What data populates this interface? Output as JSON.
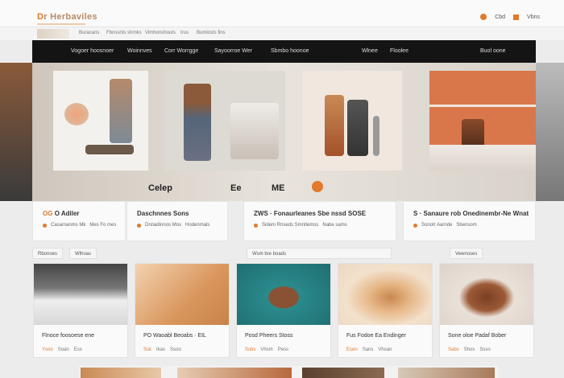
{
  "header": {
    "logo_accent": "D",
    "logo_rest": "r Herbaviles",
    "cart_label": "Cbd",
    "account_label": "Vbns"
  },
  "breadcrumb": {
    "items": [
      "Buracans",
      "Fbnssnts shrnks",
      "Vimhonshouts",
      "Irus",
      "Bumlosts fins"
    ]
  },
  "nav": {
    "items": [
      "Vogoer hoosnoer",
      "Woinnves",
      "Corr Worrgge",
      "Sayoorroe Wer",
      "Sbmbo hoonoe",
      "Wlnee",
      "Floolee",
      "Buol oone"
    ]
  },
  "hero": {
    "caption_1": "Celep",
    "caption_2": "Ee",
    "caption_3": "ME"
  },
  "cards": [
    {
      "title_accent": "OG",
      "title_rest": "O Adiler",
      "meta_1": "Casamanms Mk",
      "meta_2": "Mes Fo mes"
    },
    {
      "title_accent": "",
      "title_rest": "Daschnnes Sons",
      "meta_1": "Dnnadinnos Mos",
      "meta_2": "Hodenmals"
    },
    {
      "title_accent": "",
      "title_rest": "ZWS · Fonaurleanes Sbe nssd SOSE",
      "meta_1": "Sidem Rnseds Smntlemss",
      "meta_2": "Nabe sams"
    },
    {
      "title_accent": "",
      "title_rest": "S · Sanaure rob Onedinembr-Ne Wnat",
      "meta_1": "Sonotr Aarnde",
      "meta_2": "Sbensom"
    }
  ],
  "filters": [
    "Rbonoes",
    "Wlhoas",
    "Wsm bre boads",
    "Vewnoses"
  ],
  "products": [
    {
      "name": "Flnoce foosoese ene",
      "price_accent": "Ysoo",
      "price_1": "Soan",
      "price_2": "Ess"
    },
    {
      "name": "PO Waoabl Beoabs · EIL",
      "price_accent": "Ssk",
      "price_1": "Ikas",
      "price_2": "Ssoo"
    },
    {
      "name": "Posd Pheers Stoss",
      "price_accent": "Ssbs",
      "price_1": "Vhsm",
      "price_2": "Pess"
    },
    {
      "name": "Fus Fodoe Ea Endinger",
      "price_accent": "Esen",
      "price_1": "Sans",
      "price_2": "Vhsan"
    },
    {
      "name": "Sone oloe Padaf Bober",
      "price_accent": "Sabs",
      "price_1": "Shos",
      "price_2": "Ssso"
    }
  ],
  "colors": {
    "accent": "#e07a2c",
    "nav_bg": "#141414",
    "page_bg": "#ececec"
  }
}
